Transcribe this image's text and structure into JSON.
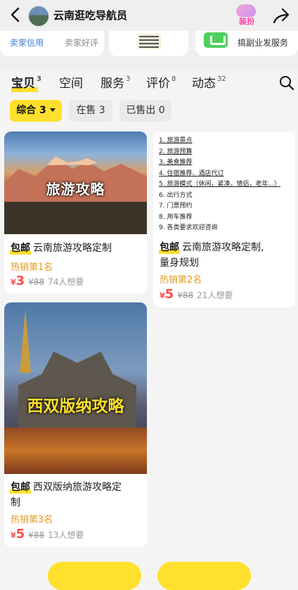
{
  "header": {
    "shop_name": "云南逛吃导航员",
    "decor_label": "装扮"
  },
  "info": {
    "credit_label": "卖家信用",
    "review_label": "卖家好评",
    "side_business_label": "搞副业发服务"
  },
  "tabs": [
    {
      "label": "宝贝",
      "count": "3"
    },
    {
      "label": "空间",
      "count": ""
    },
    {
      "label": "服务",
      "count": "3"
    },
    {
      "label": "评价",
      "count": "8"
    },
    {
      "label": "动态",
      "count": "32"
    }
  ],
  "filters": [
    {
      "label": "综合 3"
    },
    {
      "label": "在售 3"
    },
    {
      "label": "已售出 0"
    }
  ],
  "products": [
    {
      "image_text": "旅游攻略",
      "tag": "包邮",
      "title": "云南旅游攻略定制",
      "hot": "热销第1名",
      "currency": "¥",
      "price": "3",
      "original": "¥88",
      "want": "74人想要"
    },
    {
      "list_items": [
        "1. 旅游景点",
        "2. 旅游预算",
        "3. 美食推荐",
        "4. 住宿推荐、酒店代订",
        "5. 旅游模式（休闲，紧凑，情侣，老年...）",
        "6. 出行方式",
        "7. 门票预约",
        "8. 用车推荐",
        "9. 各类要求欢迎咨询"
      ],
      "tag": "包邮",
      "title": "云南旅游攻略定制,",
      "title_line2": "量身规划",
      "hot": "热销第2名",
      "currency": "¥",
      "price": "5",
      "original": "¥88",
      "want": "21人想要"
    },
    {
      "image_text": "西双版纳攻略",
      "tag": "包邮",
      "title": "西双版纳旅游攻略定",
      "title_line2": "制",
      "hot": "热销第3名",
      "currency": "¥",
      "price": "5",
      "original": "¥88",
      "want": "13人想要"
    }
  ],
  "colors": {
    "accent": "#ffe02c",
    "price": "#ff4b4b",
    "hot": "#e39a1b",
    "link": "#3b7bd6"
  }
}
